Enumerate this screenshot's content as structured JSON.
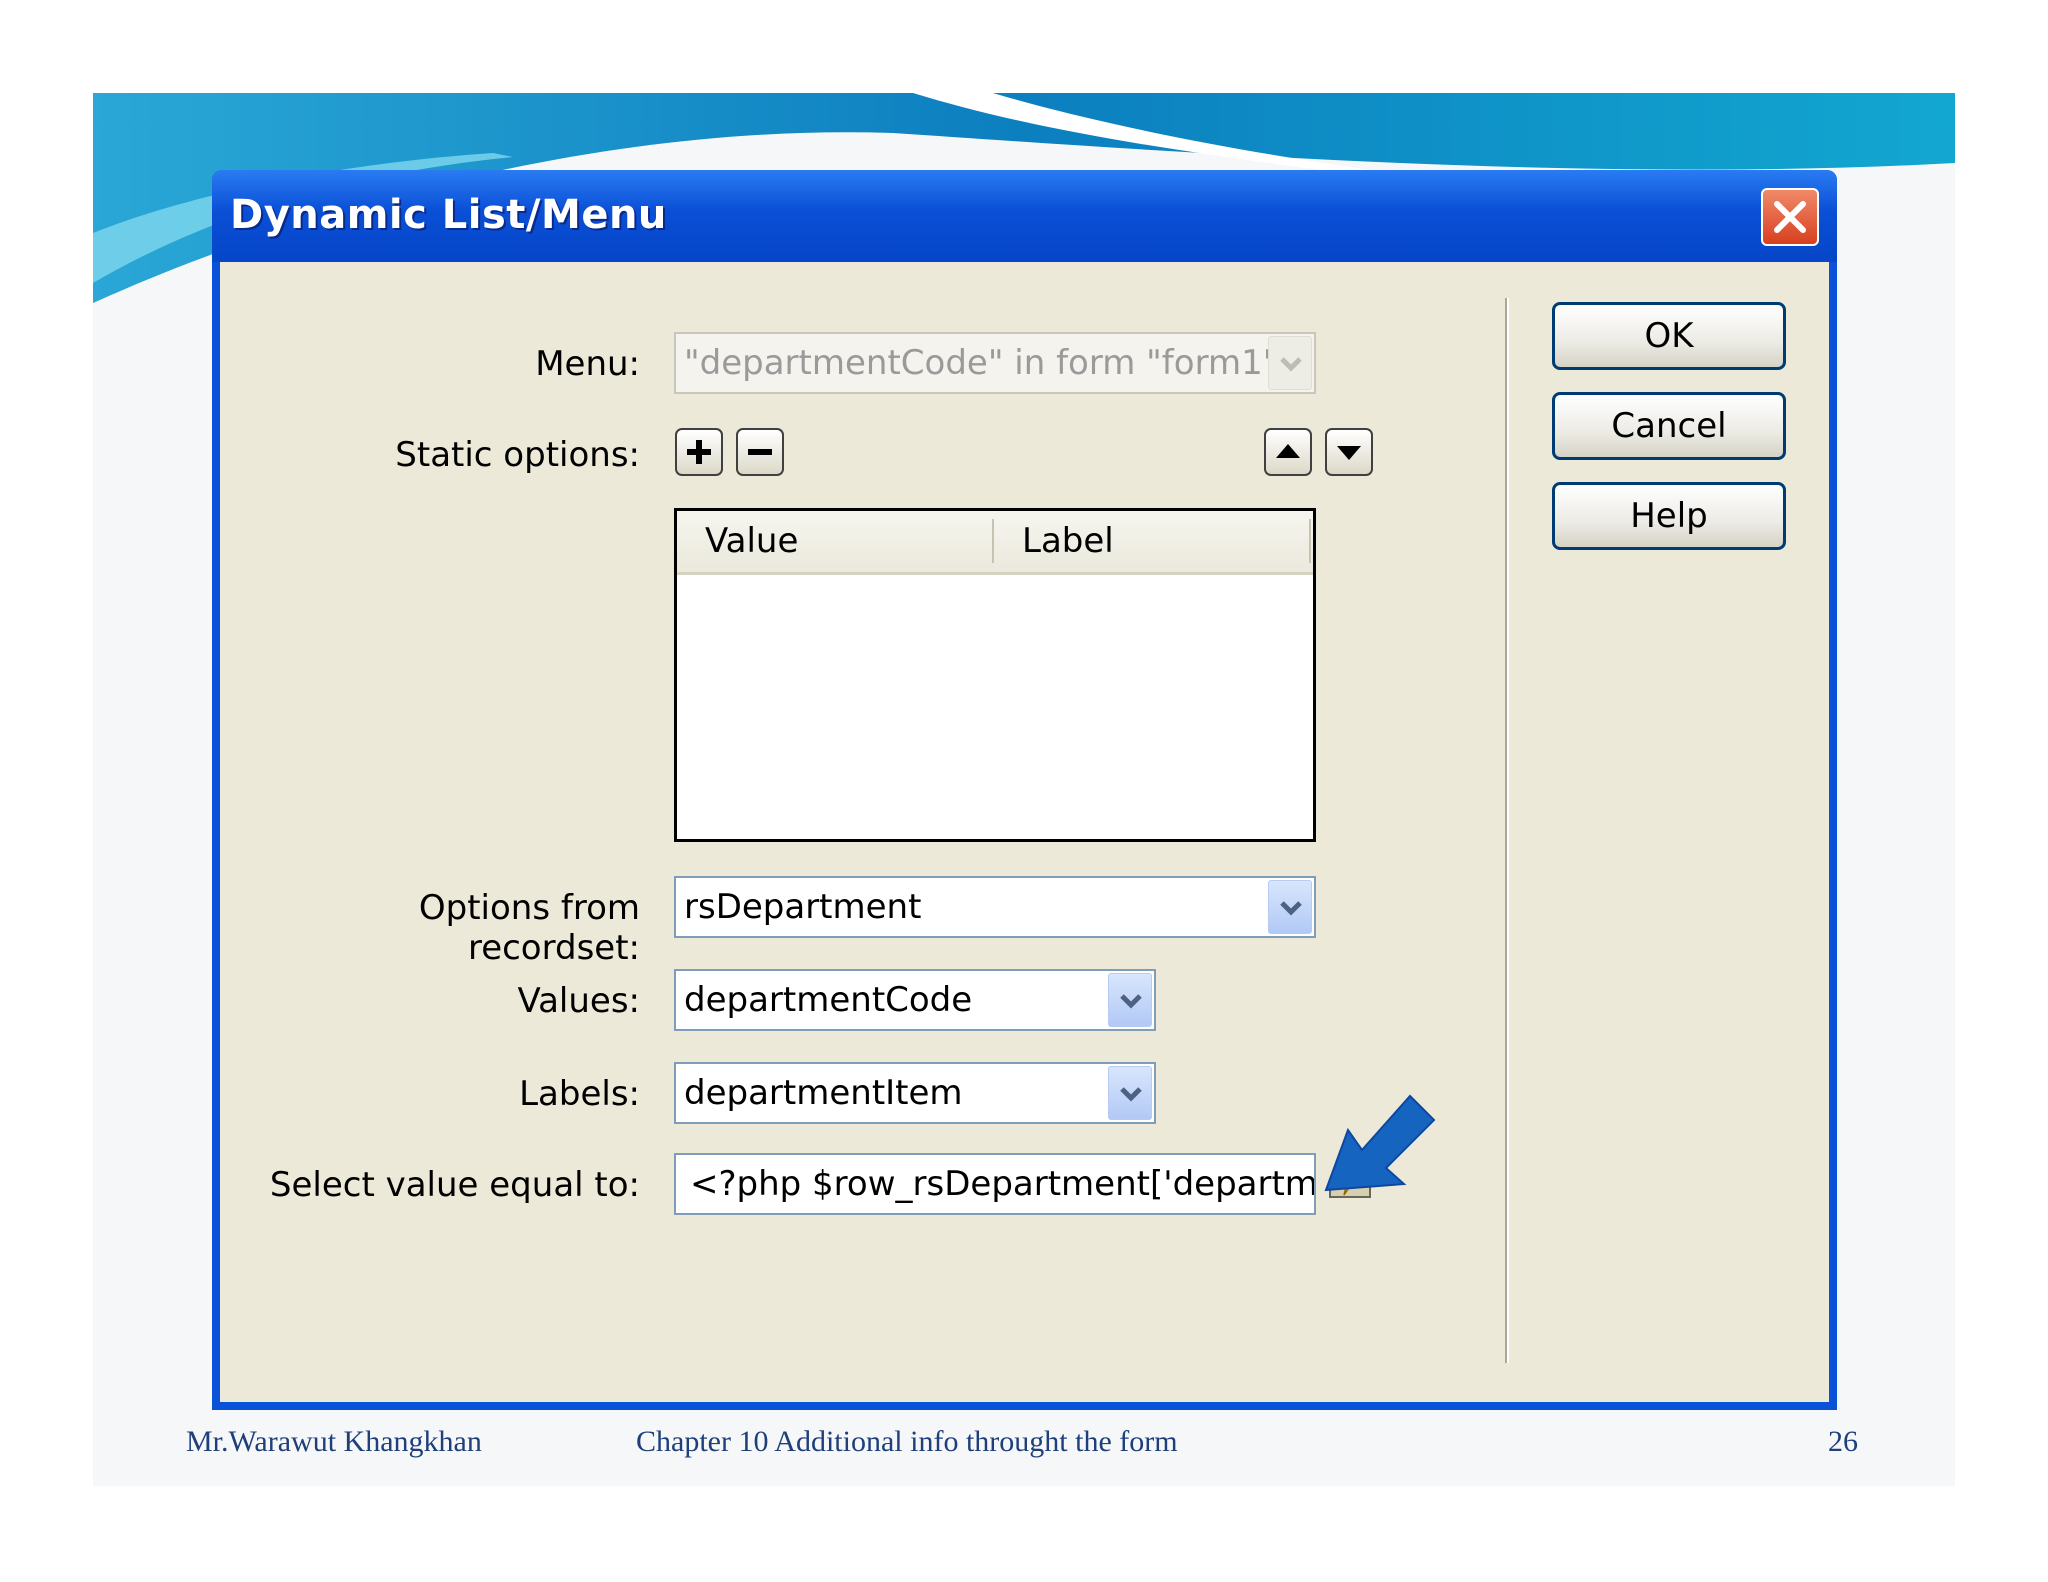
{
  "dialog": {
    "title": "Dynamic List/Menu",
    "menu": {
      "label": "Menu:",
      "value": "\"departmentCode\" in form \"form1\""
    },
    "static_options": {
      "label": "Static options:",
      "columns": [
        "Value",
        "Label"
      ],
      "rows": []
    },
    "options_from_recordset": {
      "label": "Options from recordset:",
      "value": "rsDepartment"
    },
    "values": {
      "label": "Values:",
      "value": "departmentCode"
    },
    "labels": {
      "label": "Labels:",
      "value": "departmentItem"
    },
    "select_value": {
      "label": "Select value equal to:",
      "value": "<?php $row_rsDepartment['department"
    },
    "buttons": {
      "ok": "OK",
      "cancel": "Cancel",
      "help": "Help"
    }
  },
  "footer": {
    "author": "Mr.Warawut  Khangkhan",
    "chapter": "Chapter 10 Additional info throught the form",
    "page": "26"
  },
  "colors": {
    "titlebar": "#0a52d8",
    "dialog_face": "#ece9d8",
    "footer_text": "#1f3f7a",
    "pointer_arrow": "#1565c0"
  },
  "icons": [
    "close-icon",
    "add-icon",
    "remove-icon",
    "move-up-icon",
    "move-down-icon",
    "dropdown-arrow-icon",
    "dynamic-data-lightning-icon",
    "pointer-arrow-icon"
  ]
}
